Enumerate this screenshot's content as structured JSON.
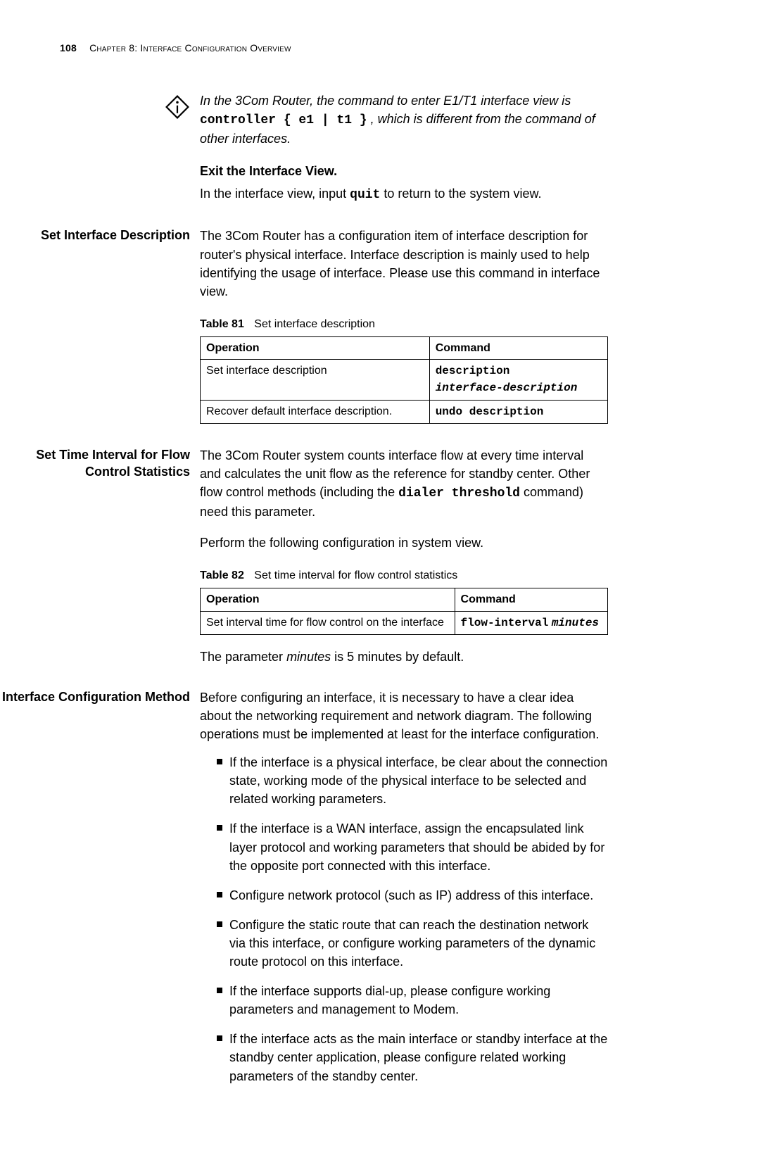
{
  "header": {
    "page_no": "108",
    "chapter": "Chapter 8: Interface Configuration Overview"
  },
  "note": {
    "t1a": "In the 3Com Router, the command to enter E1/T1 interface view is ",
    "cmd1": "controller { e1 | t1 }",
    "t1b": ", which is different from the command of other interfaces."
  },
  "exit": {
    "head": "Exit the Interface View.",
    "t1a": "In the interface view, input ",
    "cmd": "quit",
    "t1b": " to return to the system view."
  },
  "sec1": {
    "title": "Set Interface Description",
    "p": "The 3Com Router has a configuration item of interface description for router's physical interface. Interface description is mainly used to help identifying the usage of interface. Please use this command in interface view.",
    "tbl_label": "Table 81",
    "tbl_name": "Set interface description",
    "h1": "Operation",
    "h2": "Command",
    "r1c1": "Set interface description",
    "r1c2a": "description",
    "r1c2b": "interface-description",
    "r2c1": "Recover default interface description.",
    "r2c2": "undo description"
  },
  "sec2": {
    "title": "Set Time Interval for Flow Control Statistics",
    "p1a": "The 3Com Router system counts interface flow at every time interval and calculates the unit flow as the reference for standby center. Other flow control methods (including the ",
    "cmd": "dialer threshold",
    "p1b": " command) need this parameter.",
    "p2": "Perform the following configuration in system view.",
    "tbl_label": "Table 82",
    "tbl_name": "Set time interval for flow control statistics",
    "h1": "Operation",
    "h2": "Command",
    "r1c1": "Set interval time for flow control on the interface",
    "r1c2a": "flow-interval",
    "r1c2b": "minutes",
    "p3a": "The parameter ",
    "p3em": "minutes",
    "p3b": " is 5 minutes by default."
  },
  "sec3": {
    "title": "Interface Configuration Method",
    "p": "Before configuring an interface, it is necessary to have a clear idea about the networking requirement and network diagram. The following operations must be implemented at least for the interface configuration.",
    "li": [
      "If the interface is a physical interface, be clear about the connection state, working mode of the physical interface to be selected and related working parameters.",
      "If the interface is a WAN interface, assign the encapsulated link layer protocol and working parameters that should be abided by for the opposite port connected with this interface.",
      "Configure network protocol (such as IP) address of this interface.",
      "Configure the static route that can reach the destination network via this interface, or configure working parameters of the dynamic route protocol on this interface.",
      "If the interface supports dial-up, please configure working parameters and management to Modem.",
      "If the interface acts as the main interface or standby interface at the standby center application, please configure related working parameters of the standby center."
    ]
  }
}
